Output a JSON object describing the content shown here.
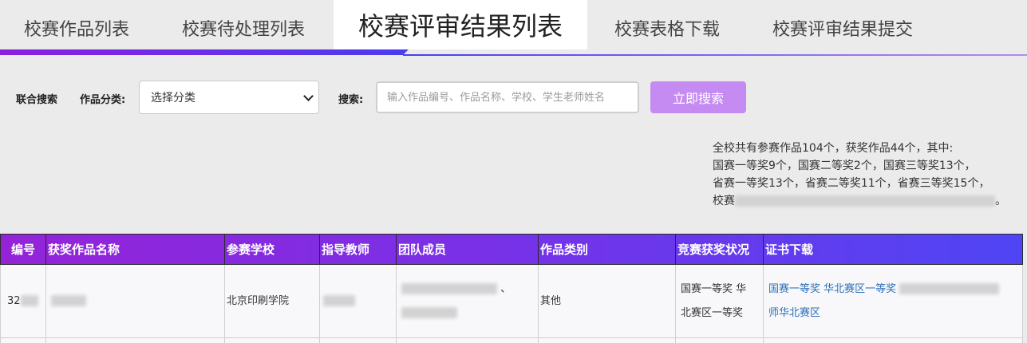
{
  "tabs": [
    {
      "label": "校赛作品列表"
    },
    {
      "label": "校赛待处理列表"
    },
    {
      "label": "校赛评审结果列表"
    },
    {
      "label": "校赛表格下载"
    },
    {
      "label": "校赛评审结果提交"
    }
  ],
  "colors": {
    "accent_purple": "#8b1fe0",
    "accent_blue": "#4b3cf0",
    "button": "#c58bf2",
    "link": "#2c6fb8"
  },
  "search": {
    "combined_label": "联合搜索",
    "category_label": "作品分类:",
    "category_selected": "选择分类",
    "keyword_label": "搜索:",
    "keyword_placeholder": "输入作品编号、作品名称、学校、学生老师姓名",
    "keyword_value": "",
    "button_label": "立即搜索"
  },
  "summary": {
    "line1": "全校共有参赛作品104个，获奖作品44个，其中:",
    "line2": "国赛一等奖9个，国赛二等奖2个，国赛三等奖13个，",
    "line3": "省赛一等奖13个，省赛二等奖11个，省赛三等奖15个，",
    "line4": "校赛",
    "line4_tail": "。"
  },
  "table": {
    "headers": [
      "编号",
      "获奖作品名称",
      "参赛学校",
      "指导教师",
      "团队成员",
      "作品类别",
      "竞赛获奖状况",
      "证书下载"
    ],
    "rows": [
      {
        "id": "32",
        "name": "",
        "school": "北京印刷学院",
        "teacher": "",
        "members": "、",
        "category": "其他",
        "award_line1": "国赛一等奖 华",
        "award_line2": "北赛区一等奖",
        "cert_line1": "国赛一等奖 华北赛区一等奖",
        "cert_line2": "师华北赛区"
      }
    ]
  }
}
